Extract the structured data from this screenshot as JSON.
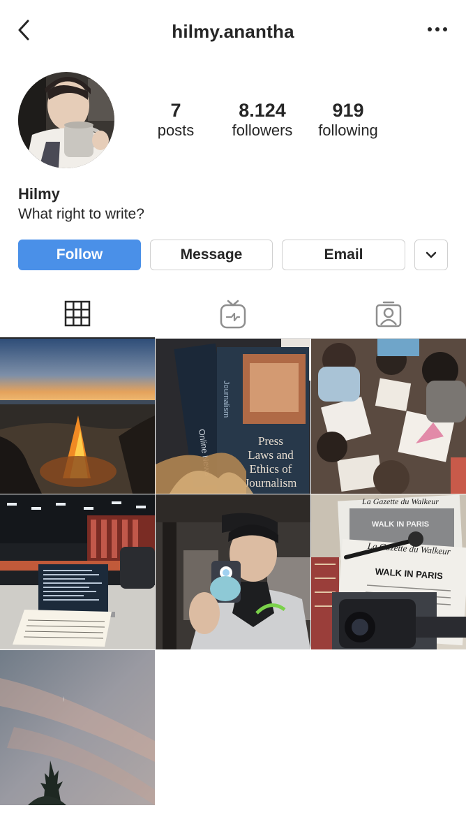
{
  "header": {
    "username": "hilmy.anantha",
    "back_icon": "chevron-left-icon",
    "more_icon": "more-horizontal-icon"
  },
  "profile": {
    "stats": [
      {
        "value": "7",
        "label": "posts"
      },
      {
        "value": "8.124",
        "label": "followers"
      },
      {
        "value": "919",
        "label": "following"
      }
    ],
    "name": "Hilmy",
    "bio": "What right to write?"
  },
  "actions": {
    "follow": "Follow",
    "message": "Message",
    "email": "Email",
    "more_icon": "chevron-down-icon"
  },
  "tabs": [
    {
      "icon": "grid-icon",
      "active": true
    },
    {
      "icon": "igtv-icon",
      "active": false
    },
    {
      "icon": "tagged-icon",
      "active": false
    }
  ],
  "colors": {
    "accent": "#4a90e8",
    "text": "#262626",
    "border": "#dbdbdb"
  },
  "posts": [
    {
      "subject": "beach-campfire-sunset"
    },
    {
      "subject": "journalism-books",
      "visible_text": [
        "Online News",
        "Journalism",
        "Press Laws and Ethics of Journalism"
      ]
    },
    {
      "subject": "children-coloring"
    },
    {
      "subject": "newsroom-laptop-notebook"
    },
    {
      "subject": "mirror-selfie"
    },
    {
      "subject": "newspapers-camera-microphone",
      "visible_text": [
        "La Gazette du Walkeur",
        "WALK IN PARIS"
      ]
    },
    {
      "subject": "sky-moon-tree"
    }
  ]
}
